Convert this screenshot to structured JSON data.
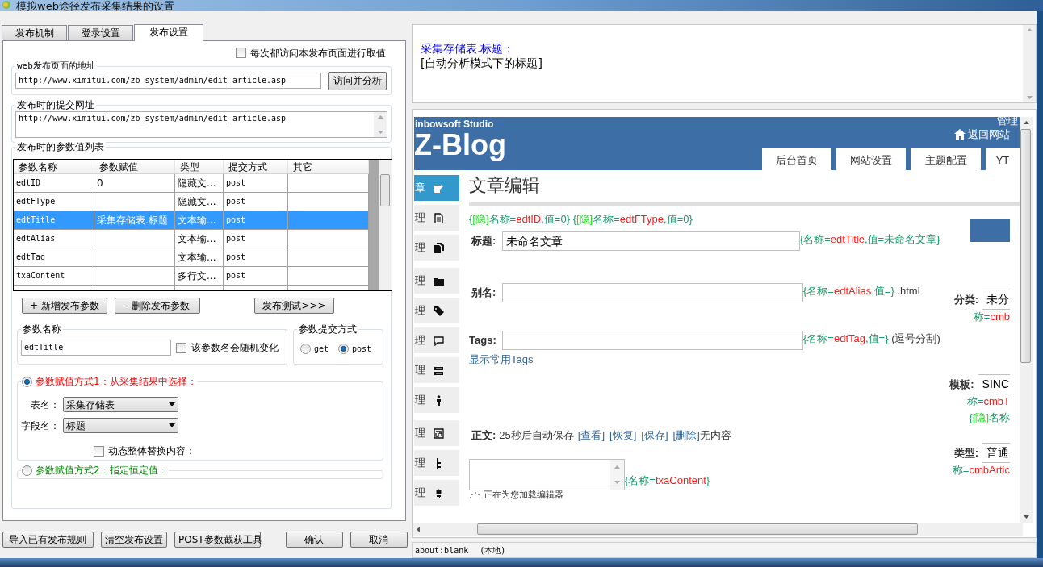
{
  "window": {
    "title": "模拟web途径发布采集结果的设置"
  },
  "tabs": [
    {
      "label": "发布机制",
      "selected": false
    },
    {
      "label": "登录设置",
      "selected": false
    },
    {
      "label": "发布设置",
      "selected": true
    }
  ],
  "visit_each_time": {
    "label": "每次都访问本发布页面进行取值",
    "checked": false
  },
  "page_url": {
    "legend": "web发布页面的地址",
    "value": "http://www.ximitui.com/zb_system/admin/edit_article.asp",
    "button": "访问并分析"
  },
  "submit_url": {
    "legend": "发布时的提交网址",
    "value": "http://www.ximitui.com/zb_system/admin/edit_article.asp"
  },
  "params": {
    "legend": "发布时的参数值列表",
    "columns": [
      "参数名称",
      "参数赋值",
      "类型",
      "提交方式",
      "其它"
    ],
    "rows": [
      {
        "cells": [
          "edtID",
          "0",
          "隐藏文...",
          "post",
          ""
        ],
        "selected": false
      },
      {
        "cells": [
          "edtFType",
          "",
          "隐藏文...",
          "post",
          ""
        ],
        "selected": false
      },
      {
        "cells": [
          "edtTitle",
          "采集存储表.标题",
          "文本输...",
          "post",
          ""
        ],
        "selected": true
      },
      {
        "cells": [
          "edtAlias",
          "",
          "文本输...",
          "post",
          ""
        ],
        "selected": false
      },
      {
        "cells": [
          "edtTag",
          "",
          "文本输...",
          "post",
          ""
        ],
        "selected": false
      },
      {
        "cells": [
          "txaContent",
          "",
          "多行文...",
          "post",
          ""
        ],
        "selected": false
      }
    ]
  },
  "param_buttons": [
    "+ 新增发布参数",
    "- 删除发布参数",
    "发布测试>>>"
  ],
  "param_name": {
    "legend": "参数名称",
    "value": "edtTitle",
    "random_label": "该参数名会随机变化",
    "random_checked": false
  },
  "submit_method": {
    "legend": "参数提交方式",
    "options": [
      {
        "label": "get",
        "selected": false
      },
      {
        "label": "post",
        "selected": true
      }
    ]
  },
  "mode1": {
    "label": "参数赋值方式1：从采集结果中选择：",
    "selected": true,
    "table_label": "表名：",
    "table_value": "采集存储表",
    "field_label": "字段名：",
    "field_value": "标题",
    "replace_label": "动态整体替换内容：",
    "replace_checked": false
  },
  "mode2": {
    "label": "参数赋值方式2：指定恒定值：",
    "selected": false
  },
  "bottom_buttons": [
    "导入已有发布规则",
    "清空发布设置",
    "POST参数截获工具",
    "确认",
    "取消"
  ],
  "preview": {
    "source": "采集存储表.标题：",
    "text": "[自动分析模式下的标题]"
  },
  "browser": {
    "studio": "inbowsoft Studio",
    "logo": "Z-Blog",
    "manage": "管理",
    "back": "返回网站",
    "nav": [
      {
        "label": "后台首页"
      },
      {
        "label": "网站设置"
      },
      {
        "label": "主题配置"
      },
      {
        "label": "YT"
      }
    ],
    "sidebar": [
      {
        "label": "章",
        "selected": true
      },
      {
        "label": "理",
        "selected": false
      },
      {
        "label": "理",
        "selected": false
      },
      {
        "label": "理",
        "selected": false
      },
      {
        "label": "理",
        "selected": false
      },
      {
        "label": "理",
        "selected": false
      },
      {
        "label": "理",
        "selected": false
      },
      {
        "label": "理",
        "selected": false
      },
      {
        "label": "理",
        "selected": false
      },
      {
        "label": "理",
        "selected": false
      },
      {
        "label": "理",
        "selected": false
      }
    ],
    "heading": "文章编辑",
    "hidden_note": [
      {
        "kind": "teal",
        "text": "{"
      },
      {
        "kind": "hidden",
        "text": "[隐]"
      },
      {
        "kind": "teal",
        "text": "名称="
      },
      {
        "kind": "name",
        "text": "edtID"
      },
      {
        "kind": "teal",
        "text": ",值=0} {"
      },
      {
        "kind": "hidden",
        "text": "[隐]"
      },
      {
        "kind": "teal",
        "text": "名称="
      },
      {
        "kind": "name",
        "text": "edtFType"
      },
      {
        "kind": "teal",
        "text": ",值=0}"
      }
    ],
    "fields": [
      {
        "label": "标题:",
        "value": "未命名文章",
        "note": [
          {
            "kind": "teal",
            "text": "{名称="
          },
          {
            "kind": "name",
            "text": "edtTitle"
          },
          {
            "kind": "teal",
            "text": ",值=未命名文章}"
          }
        ]
      },
      {
        "label": "别名:",
        "note": [
          {
            "kind": "teal",
            "text": "{名称="
          },
          {
            "kind": "name",
            "text": "edtAlias"
          },
          {
            "kind": "teal",
            "text": ",值=}"
          },
          {
            "kind": "plain",
            "text": " .html"
          }
        ]
      },
      {
        "label": "Tags:",
        "note": [
          {
            "kind": "teal",
            "text": "{名称="
          },
          {
            "kind": "name",
            "text": "edtTag"
          },
          {
            "kind": "teal",
            "text": ",值=}"
          },
          {
            "kind": "plain",
            "text": " (逗号分割)"
          }
        ]
      }
    ],
    "tags_link": "显示常用Tags",
    "body_label": "正文:",
    "autosave": "25秒后自动保存",
    "body_links": [
      "[查看]",
      "[恢复]",
      "[保存]",
      "[删除]"
    ],
    "body_status": "无内容",
    "content_note": [
      {
        "kind": "teal",
        "text": "{名称="
      },
      {
        "kind": "name",
        "text": "txaContent"
      },
      {
        "kind": "teal",
        "text": "}"
      }
    ],
    "loading": "正在为您加载编辑器",
    "side_fields": [
      {
        "label": "分类:",
        "value": "未分",
        "note": [
          {
            "kind": "teal",
            "text": "称="
          },
          {
            "kind": "name",
            "text": "cmb"
          }
        ]
      },
      {
        "label": "模板:",
        "value": "SINC",
        "note": [
          {
            "kind": "teal",
            "text": "称="
          },
          {
            "kind": "name",
            "text": "cmbT"
          }
        ],
        "note2": [
          {
            "kind": "teal",
            "text": "{"
          },
          {
            "kind": "hidden",
            "text": "[隐]"
          },
          {
            "kind": "teal",
            "text": "名称"
          }
        ]
      },
      {
        "label": "类型:",
        "value": "普通",
        "note": [
          {
            "kind": "teal",
            "text": "称="
          },
          {
            "kind": "name",
            "text": "cmbArtic"
          }
        ]
      }
    ]
  },
  "status_bar": {
    "url": "about:blank",
    "zone": "(本地)"
  }
}
